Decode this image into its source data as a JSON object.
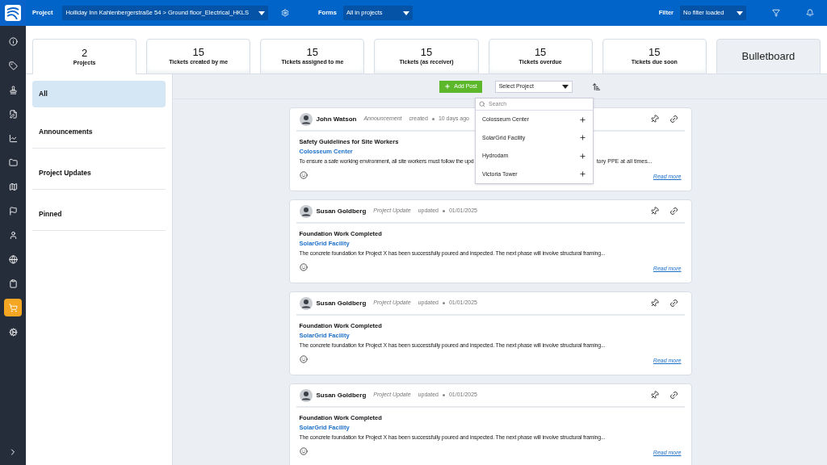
{
  "topbar": {
    "project_label": "Project",
    "project_value": "Holliday Inn Kahlenbergerstraße 54 > Ground floor_Electrical_HKLS",
    "forms_label": "Forms",
    "forms_value": "All in projects",
    "filter_label": "Filter",
    "filter_value": "No filter loaded"
  },
  "rail": [
    {
      "selected": false
    },
    {
      "selected": false
    },
    {
      "selected": false
    },
    {
      "selected": false
    },
    {
      "selected": false
    },
    {
      "selected": false
    },
    {
      "selected": false
    },
    {
      "selected": false
    },
    {
      "selected": false
    },
    {
      "selected": false
    },
    {
      "selected": false
    },
    {
      "selected": true
    },
    {
      "selected": false
    }
  ],
  "stat_tabs": [
    {
      "kind": "stat",
      "count": "2",
      "label": "Projects",
      "selected": true
    },
    {
      "kind": "stat",
      "count": "15",
      "label": "Tickets created by me",
      "selected": false
    },
    {
      "kind": "stat",
      "count": "15",
      "label": "Tickets assigned to me",
      "selected": false
    },
    {
      "kind": "stat",
      "count": "15",
      "label": "Tickets (as receiver)",
      "selected": false
    },
    {
      "kind": "stat",
      "count": "15",
      "label": "Tickets overdue",
      "selected": false
    },
    {
      "kind": "stat",
      "count": "15",
      "label": "Tickets due soon",
      "selected": false
    },
    {
      "kind": "title",
      "label": "Bulletboard",
      "selected": false
    }
  ],
  "categories": [
    {
      "label": "All",
      "selected": true
    },
    {
      "label": "Announcements",
      "selected": false
    },
    {
      "label": "Project Updates",
      "selected": false
    },
    {
      "label": "Pinned",
      "selected": false
    }
  ],
  "toolbar": {
    "add_post": "Add Post",
    "select_project": "Select Project"
  },
  "project_dropdown": {
    "placeholder": "Search",
    "items": [
      "Colosseum Center",
      "SolarGrid Facility",
      "Hydrodam",
      "Victoria Tower"
    ]
  },
  "posts": [
    {
      "author": "John Watson",
      "type": "Announcement",
      "action": "created",
      "date": "10 days ago",
      "title": "Safety Guidelines for Site Workers",
      "project": "Colosseum Center",
      "body": "To ensure a safe working environment, all site workers must follow the upd",
      "body_end": "tory PPE at all times...",
      "read_more": "Read more"
    },
    {
      "author": "Susan Goldberg",
      "type": "Project Update",
      "action": "updated",
      "date": "01/01/2025",
      "title": "Foundation Work Completed",
      "project": "SolarGrid Facility",
      "body": "The concrete foundation for Project X has been successfully poured and inspected. The next phase will involve structural framing...",
      "read_more": "Read more"
    },
    {
      "author": "Susan Goldberg",
      "type": "Project Update",
      "action": "updated",
      "date": "01/01/2025",
      "title": "Foundation Work Completed",
      "project": "SolarGrid Facility",
      "body": "The concrete foundation for Project X has been successfully poured and inspected. The next phase will involve structural framing...",
      "read_more": "Read more"
    },
    {
      "author": "Susan Goldberg",
      "type": "Project Update",
      "action": "updated",
      "date": "01/01/2025",
      "title": "Foundation Work Completed",
      "project": "SolarGrid Facility",
      "body": "The concrete foundation for Project X has been successfully poured and inspected. The next phase will involve structural framing...",
      "read_more": "Read more"
    }
  ]
}
